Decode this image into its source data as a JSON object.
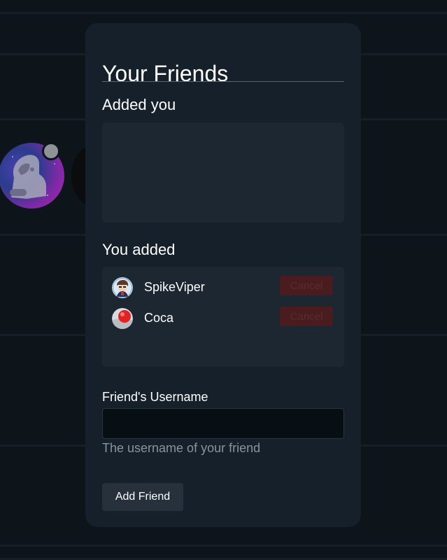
{
  "modal": {
    "title": "Your Friends",
    "added_you": {
      "heading": "Added you",
      "items": []
    },
    "you_added": {
      "heading": "You added",
      "items": [
        {
          "name": "SpikeViper",
          "action": "Cancel"
        },
        {
          "name": "Coca",
          "action": "Cancel"
        }
      ]
    },
    "form": {
      "label": "Friend's Username",
      "value": "",
      "placeholder": "",
      "helper": "The username of your friend",
      "submit_label": "Add Friend"
    }
  },
  "colors": {
    "page_background": "#0b1116",
    "modal_background": "#15202a",
    "panel_background": "#1c2731",
    "cancel_background": "#4a1c1f",
    "button_background": "#26313b",
    "avatar_status": "#8d9398"
  }
}
